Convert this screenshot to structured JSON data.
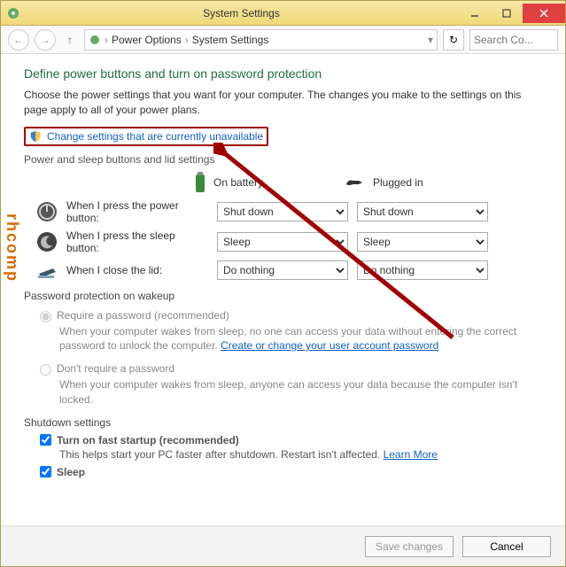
{
  "window": {
    "title": "System Settings"
  },
  "breadcrumb": {
    "item1": "Power Options",
    "item2": "System Settings"
  },
  "search": {
    "placeholder": "Search Co..."
  },
  "page": {
    "heading": "Define power buttons and turn on password protection",
    "description": "Choose the power settings that you want for your computer. The changes you make to the settings on this page apply to all of your power plans.",
    "change_link": "Change settings that are currently unavailable"
  },
  "buttons_section": {
    "subhead": "Power and sleep buttons and lid settings",
    "col_battery": "On battery",
    "col_plugged": "Plugged in",
    "rows": [
      {
        "label": "When I press the power button:",
        "battery": "Shut down",
        "plugged": "Shut down"
      },
      {
        "label": "When I press the sleep button:",
        "battery": "Sleep",
        "plugged": "Sleep"
      },
      {
        "label": "When I close the lid:",
        "battery": "Do nothing",
        "plugged": "Do nothing"
      }
    ]
  },
  "password_section": {
    "subhead": "Password protection on wakeup",
    "opt1": {
      "label": "Require a password (recommended)",
      "desc_pre": "When your computer wakes from sleep, no one can access your data without entering the correct password to unlock the computer. ",
      "link": "Create or change your user account password"
    },
    "opt2": {
      "label": "Don't require a password",
      "desc": "When your computer wakes from sleep, anyone can access your data because the computer isn't locked."
    }
  },
  "shutdown_section": {
    "subhead": "Shutdown settings",
    "fast": {
      "label": "Turn on fast startup (recommended)",
      "desc_pre": "This helps start your PC faster after shutdown. Restart isn't affected. ",
      "link": "Learn More"
    },
    "sleep": {
      "label": "Sleep"
    }
  },
  "footer": {
    "save": "Save changes",
    "cancel": "Cancel"
  },
  "watermark": "rhcomp"
}
